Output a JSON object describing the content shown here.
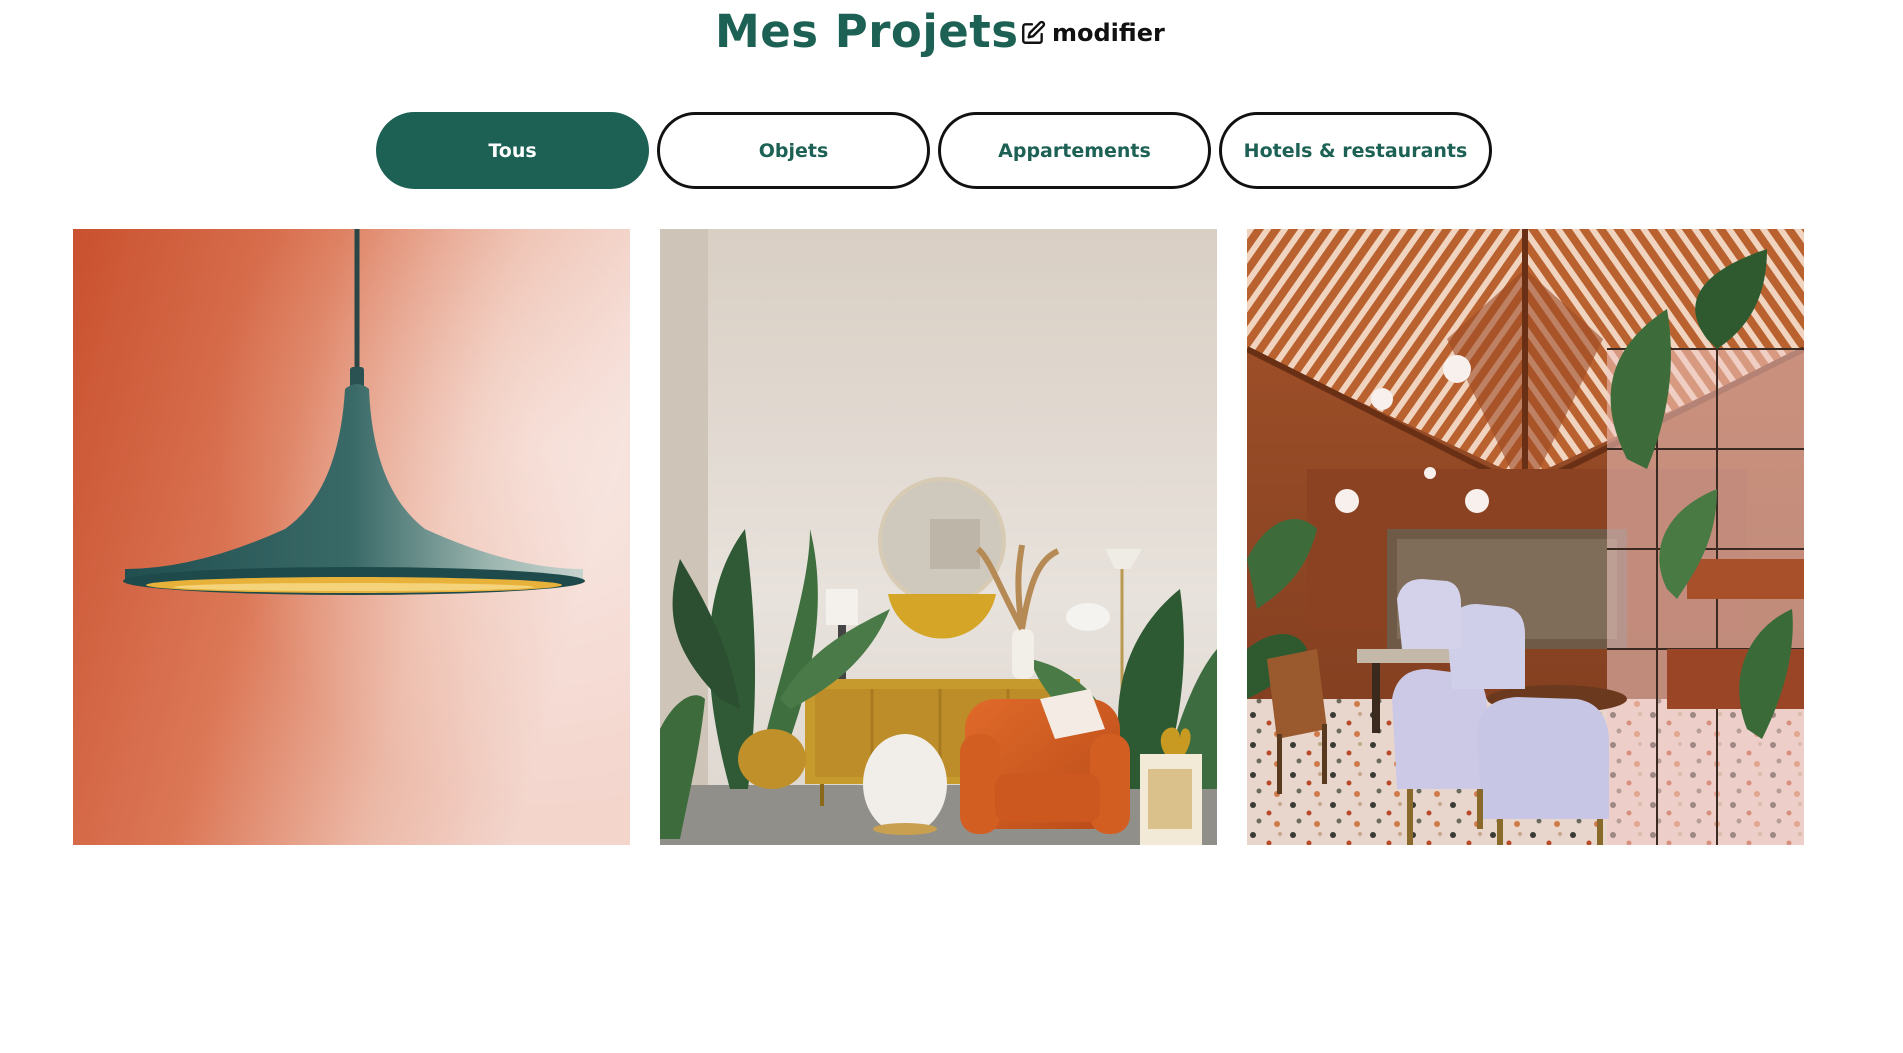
{
  "header": {
    "title": "Mes Projets",
    "edit_label": "modifier",
    "edit_icon": "pen-to-square-icon"
  },
  "filters": {
    "items": [
      {
        "label": "Tous",
        "active": true
      },
      {
        "label": "Objets",
        "active": false
      },
      {
        "label": "Appartements",
        "active": false
      },
      {
        "label": "Hotels & restaurants",
        "active": false
      }
    ]
  },
  "gallery": {
    "items": [
      {
        "subject": "pendant lamp on orange wall"
      },
      {
        "subject": "living room with orange armchair and plants"
      },
      {
        "subject": "restaurant with wooden roof and lilac chairs"
      }
    ]
  },
  "colors": {
    "brand": "#1d6154",
    "text_dark": "#111111",
    "background": "#ffffff"
  }
}
